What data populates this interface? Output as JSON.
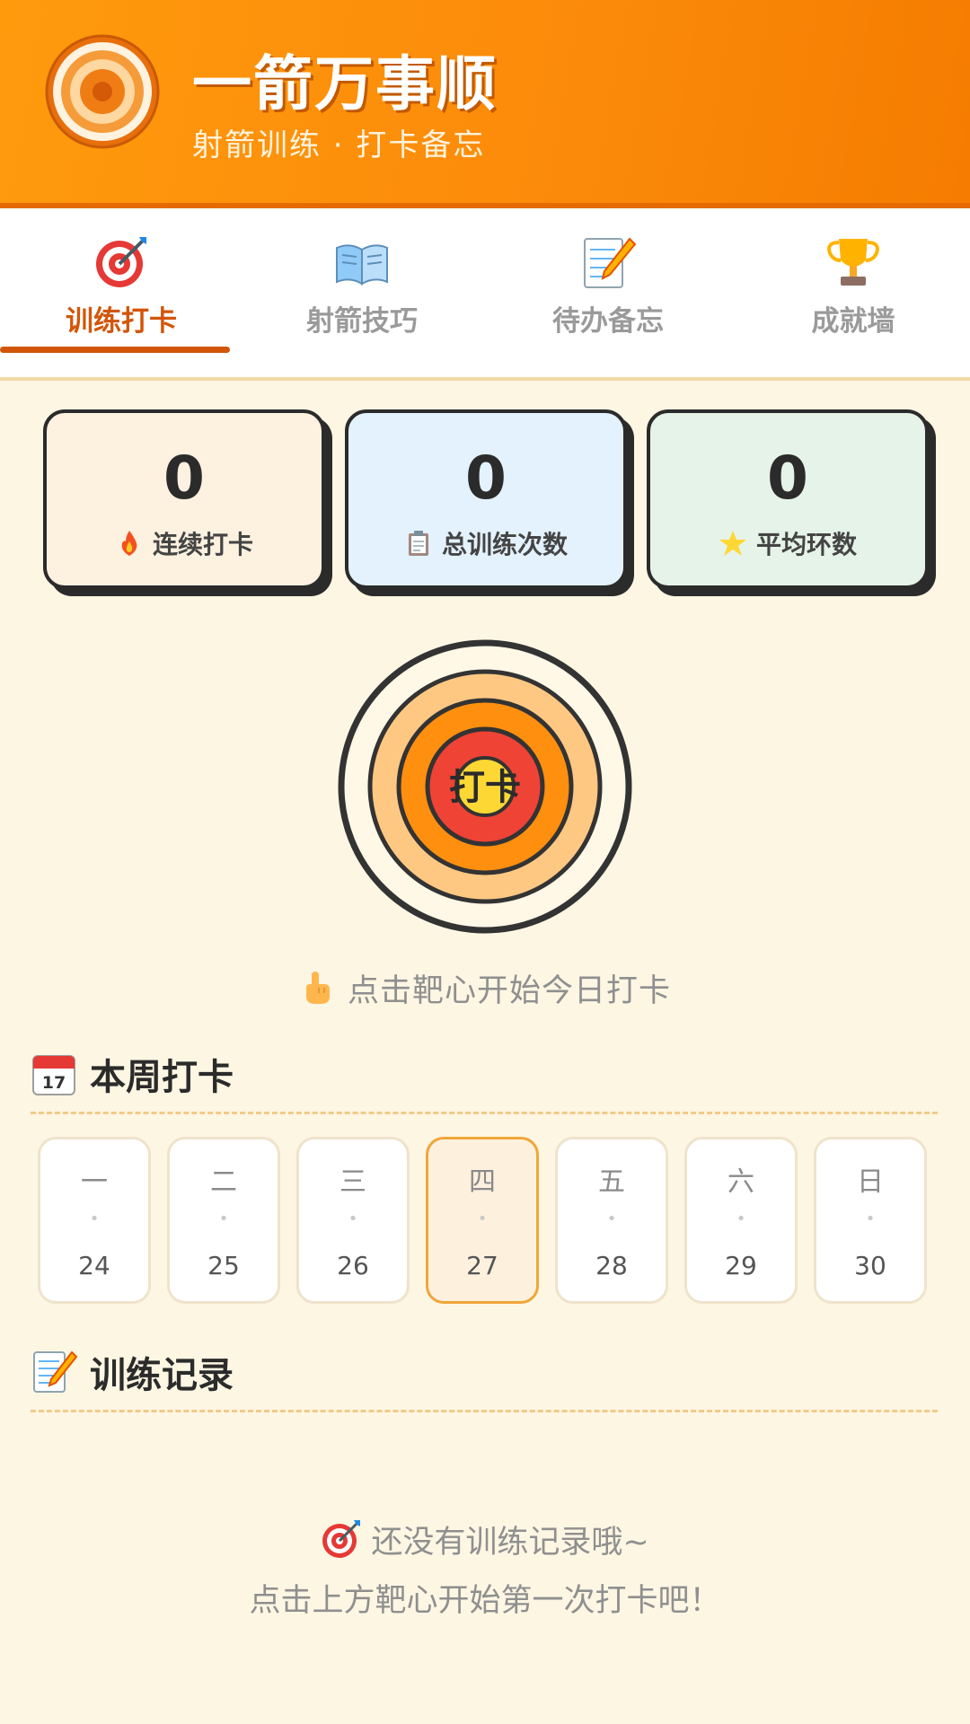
{
  "header": {
    "title": "一箭万事顺",
    "subtitle": "射箭训练 · 打卡备忘",
    "logo_icon": "archery-target-logo"
  },
  "tabs": [
    {
      "label": "训练打卡",
      "icon": "direct-hit-icon",
      "active": true
    },
    {
      "label": "射箭技巧",
      "icon": "open-book-icon",
      "active": false
    },
    {
      "label": "待办备忘",
      "icon": "memo-icon",
      "active": false
    },
    {
      "label": "成就墙",
      "icon": "trophy-icon",
      "active": false
    }
  ],
  "stats": [
    {
      "value": "0",
      "label": "连续打卡",
      "icon": "fire-icon",
      "bg": "#fdf1e0"
    },
    {
      "value": "0",
      "label": "总训练次数",
      "icon": "clipboard-icon",
      "bg": "#e3f2fd"
    },
    {
      "value": "0",
      "label": "平均环数",
      "icon": "star-icon",
      "bg": "#e6f3e8"
    }
  ],
  "target": {
    "center_label": "打卡",
    "hint": "点击靶心开始今日打卡",
    "hint_icon": "pointing-up-icon"
  },
  "week": {
    "title": "本周打卡",
    "icon": "calendar-icon",
    "days": [
      {
        "name": "一",
        "date": "24",
        "today": false
      },
      {
        "name": "二",
        "date": "25",
        "today": false
      },
      {
        "name": "三",
        "date": "26",
        "today": false
      },
      {
        "name": "四",
        "date": "27",
        "today": true
      },
      {
        "name": "五",
        "date": "28",
        "today": false
      },
      {
        "name": "六",
        "date": "29",
        "today": false
      },
      {
        "name": "日",
        "date": "30",
        "today": false
      }
    ],
    "dot": "•"
  },
  "records": {
    "title": "训练记录",
    "icon": "memo-icon",
    "empty_title": "还没有训练记录哦~",
    "empty_sub": "点击上方靶心开始第一次打卡吧！",
    "empty_icon": "direct-hit-icon"
  },
  "colors": {
    "brand_orange": "#fb8a0a",
    "accent_red": "#d2560a",
    "page_bg": "#fdf6e3"
  }
}
